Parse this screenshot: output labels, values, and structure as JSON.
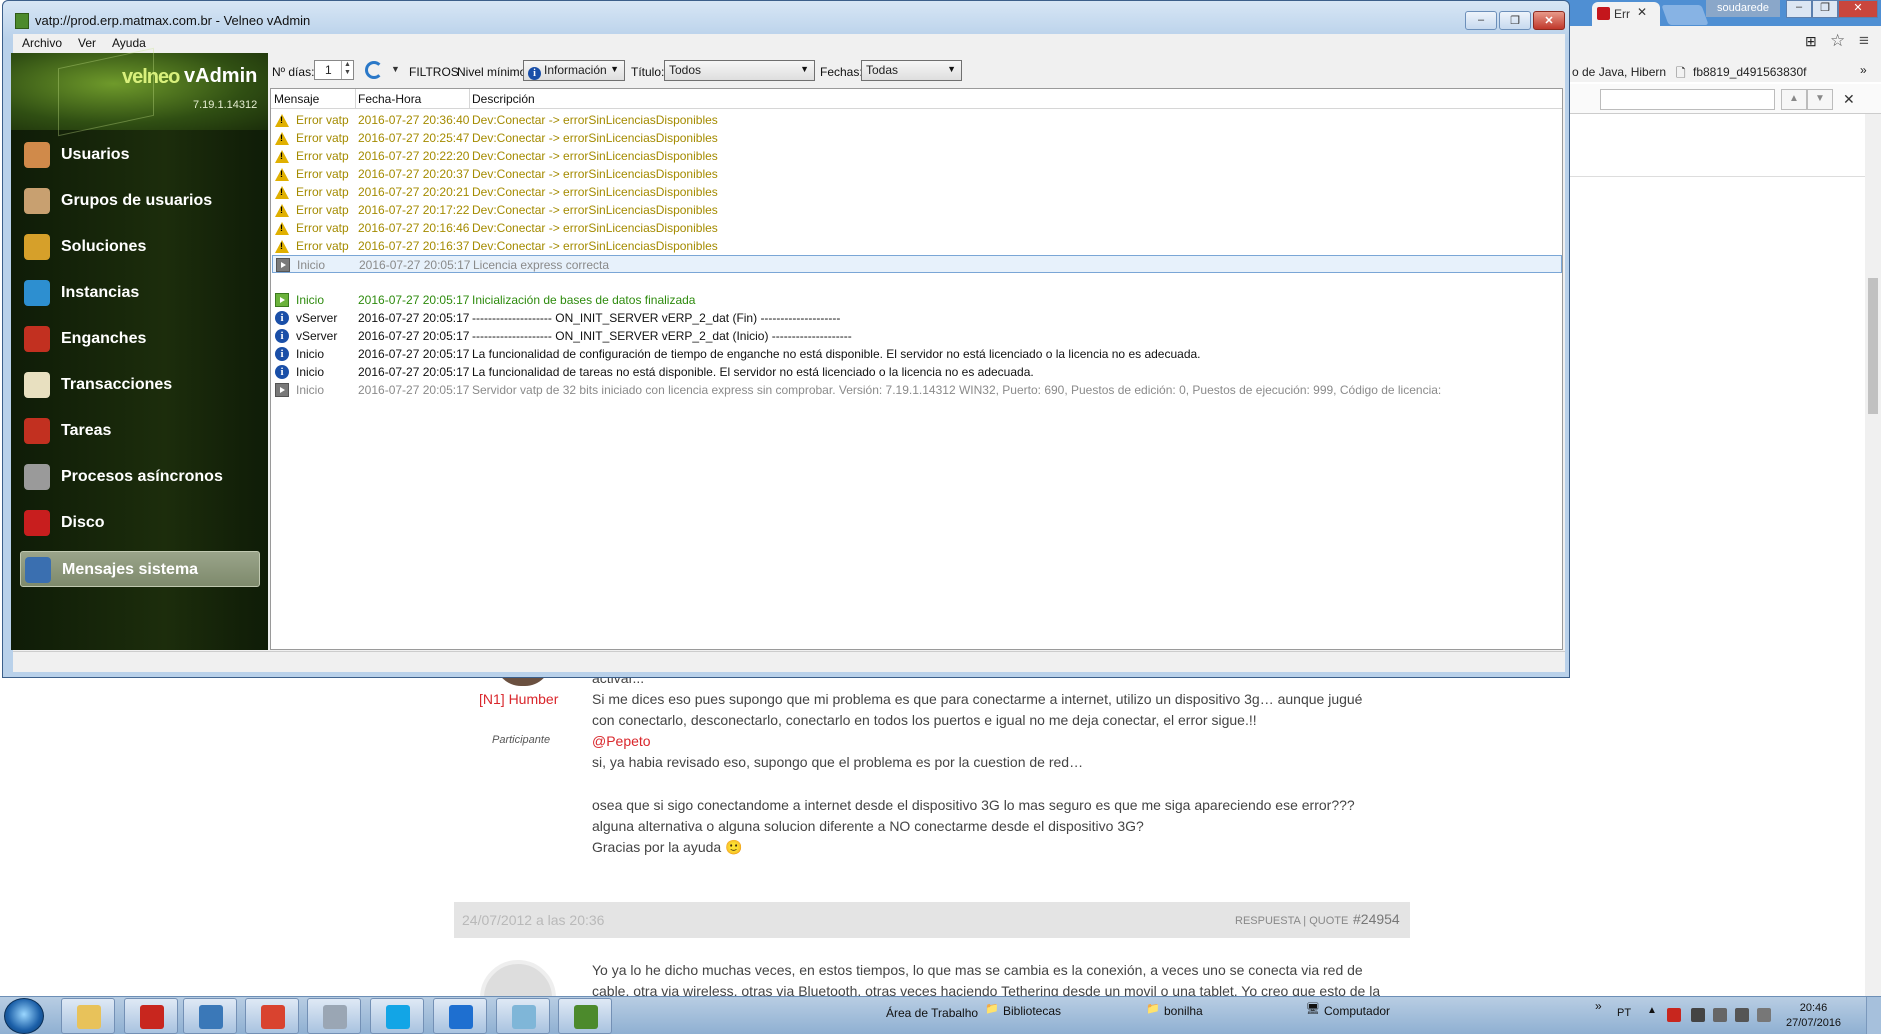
{
  "browser": {
    "tab_label": "Err",
    "profile_label": "soudarede",
    "bookmark_1": "o de Java, Hibern",
    "bookmark_2": "fb8819_d491563830f",
    "forum": {
      "author": "[N1] Humber",
      "role": "Participante",
      "line_0": "activar...",
      "line_1": "Si me dices eso pues supongo que mi problema es que para conectarme a internet, utilizo un dispositivo 3g… aunque jugué",
      "line_2": "con conectarlo, desconectarlo, conectarlo en todos los puertos e igual no me deja conectar, el error sigue.!!",
      "mention": "@Pepeto",
      "line_3": "si, ya habia revisado eso, supongo que el problema es por la cuestion de red…",
      "line_4": "osea que si sigo conectandome a internet desde el dispositivo 3G lo mas seguro es que me siga apareciendo ese error???",
      "line_5": "alguna alternativa o alguna solucion diferente a NO conectarme desde el dispositivo 3G?",
      "line_6": "Gracias por la ayuda 🙂",
      "post2_date": "24/07/2012 a las 20:36",
      "post2_reply": "RESPUESTA",
      "post2_sep": "|",
      "post2_quote": "QUOTE",
      "post2_number": "#24954",
      "post2_line_1": "Yo ya lo he dicho muchas veces, en estos tiempos, lo que mas se cambia es la conexión, a veces uno se conecta via red de",
      "post2_line_2": "cable, otra via wireless, otras via Bluetooth, otras veces haciendo Tethering desde un movil o una tablet. Yo creo que esto de la"
    }
  },
  "window": {
    "title": "vatp://prod.erp.matmax.com.br - Velneo vAdmin",
    "menu": [
      "Archivo",
      "Ver",
      "Ayuda"
    ],
    "logo_brand": "velneo",
    "logo_product": "vAdmin",
    "version": "7.19.1.14312"
  },
  "sidebar": {
    "items": [
      {
        "label": "Usuarios",
        "icon": "users-icon",
        "color": "#d08a4a"
      },
      {
        "label": "Grupos de usuarios",
        "icon": "user-groups-icon",
        "color": "#c8a070"
      },
      {
        "label": "Soluciones",
        "icon": "package-icon",
        "color": "#d6a02a"
      },
      {
        "label": "Instancias",
        "icon": "cube-icon",
        "color": "#2d8fd0"
      },
      {
        "label": "Enganches",
        "icon": "chain-icon",
        "color": "#c23020"
      },
      {
        "label": "Transacciones",
        "icon": "document-pencil-icon",
        "color": "#e8e0c0"
      },
      {
        "label": "Tareas",
        "icon": "task-gear-icon",
        "color": "#c23020"
      },
      {
        "label": "Procesos asíncronos",
        "icon": "gear-icon",
        "color": "#9a9a9a"
      },
      {
        "label": "Disco",
        "icon": "floppy-disk-icon",
        "color": "#c81e1e"
      },
      {
        "label": "Mensajes sistema",
        "icon": "log-list-icon",
        "color": "#3a6fb0",
        "active": true
      }
    ]
  },
  "toolbar": {
    "days_label": "Nº días:",
    "days_value": "1",
    "filters_label": "FILTROS",
    "min_level_label": "Nivel mínimo:",
    "min_level_value": "Información",
    "title_label": "Título:",
    "title_value": "Todos",
    "dates_label": "Fechas:",
    "dates_value": "Todas"
  },
  "log": {
    "columns": [
      "Mensaje",
      "Fecha-Hora",
      "Descripción"
    ],
    "rows": [
      {
        "type": "Error vatp",
        "datetime": "2016-07-27 20:36:40",
        "description": "Dev:Conectar -> errorSinLicenciasDisponibles",
        "severity": "warning"
      },
      {
        "type": "Error vatp",
        "datetime": "2016-07-27 20:25:47",
        "description": "Dev:Conectar -> errorSinLicenciasDisponibles",
        "severity": "warning"
      },
      {
        "type": "Error vatp",
        "datetime": "2016-07-27 20:22:20",
        "description": "Dev:Conectar -> errorSinLicenciasDisponibles",
        "severity": "warning"
      },
      {
        "type": "Error vatp",
        "datetime": "2016-07-27 20:20:37",
        "description": "Dev:Conectar -> errorSinLicenciasDisponibles",
        "severity": "warning"
      },
      {
        "type": "Error vatp",
        "datetime": "2016-07-27 20:20:21",
        "description": "Dev:Conectar -> errorSinLicenciasDisponibles",
        "severity": "warning"
      },
      {
        "type": "Error vatp",
        "datetime": "2016-07-27 20:17:22",
        "description": "Dev:Conectar -> errorSinLicenciasDisponibles",
        "severity": "warning"
      },
      {
        "type": "Error vatp",
        "datetime": "2016-07-27 20:16:46",
        "description": "Dev:Conectar -> errorSinLicenciasDisponibles",
        "severity": "warning"
      },
      {
        "type": "Error vatp",
        "datetime": "2016-07-27 20:16:37",
        "description": "Dev:Conectar -> errorSinLicenciasDisponibles",
        "severity": "warning"
      },
      {
        "type": "Inicio",
        "datetime": "2016-07-27 20:05:17",
        "description": "Licencia express correcta",
        "severity": "muted",
        "selected": true
      },
      {
        "type": "",
        "datetime": "",
        "description": "",
        "severity": "blank"
      },
      {
        "type": "Inicio",
        "datetime": "2016-07-27 20:05:17",
        "description": "Inicialización de bases de datos finalizada",
        "severity": "green"
      },
      {
        "type": "vServer",
        "datetime": "2016-07-27 20:05:17",
        "description": "-------------------- ON_INIT_SERVER vERP_2_dat (Fin) --------------------",
        "severity": "info"
      },
      {
        "type": "vServer",
        "datetime": "2016-07-27 20:05:17",
        "description": "-------------------- ON_INIT_SERVER vERP_2_dat (Inicio) --------------------",
        "severity": "info"
      },
      {
        "type": "Inicio",
        "datetime": "2016-07-27 20:05:17",
        "description": "La funcionalidad de configuración de tiempo de enganche no está disponible. El servidor no está licenciado o la licencia no es adecuada.",
        "severity": "info"
      },
      {
        "type": "Inicio",
        "datetime": "2016-07-27 20:05:17",
        "description": "La funcionalidad de tareas no está disponible. El servidor no está licenciado o la licencia no es adecuada.",
        "severity": "info"
      },
      {
        "type": "Inicio",
        "datetime": "2016-07-27 20:05:17",
        "description": "Servidor vatp de 32 bits iniciado con licencia express sin comprobar. Versión: 7.19.1.14312 WIN32, Puerto: 690, Puestos de edición: 0, Puestos de ejecución: 999, Código de licencia:",
        "severity": "muted"
      }
    ]
  },
  "taskbar": {
    "desktop_label": "Área de Trabalho",
    "libraries_label": "Bibliotecas",
    "user_label": "bonilha",
    "computer_label": "Computador",
    "language": "PT",
    "time": "20:46",
    "date": "27/07/2016",
    "apps": [
      {
        "name": "explorer-icon",
        "color": "#e8c25a"
      },
      {
        "name": "pdf-icon",
        "color": "#c8261e"
      },
      {
        "name": "photo-viewer-icon",
        "color": "#3a78b8"
      },
      {
        "name": "chrome-icon",
        "color": "#d9432f"
      },
      {
        "name": "calculator-icon",
        "color": "#9aa6b4"
      },
      {
        "name": "skype-icon",
        "color": "#12a5e6"
      },
      {
        "name": "teamviewer-icon",
        "color": "#1e6fd0"
      },
      {
        "name": "notepad-icon",
        "color": "#7fb6d8"
      },
      {
        "name": "velneo-icon",
        "color": "#4c8a2c"
      }
    ]
  }
}
